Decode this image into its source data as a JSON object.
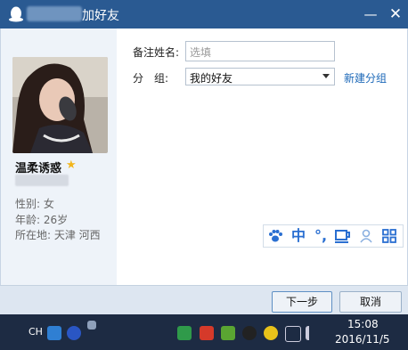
{
  "window": {
    "title_suffix": "加好友",
    "minimize_glyph": "—",
    "close_glyph": "✕"
  },
  "contact": {
    "name": "温柔诱惑",
    "star_glyph": "★",
    "gender_line": "性别: 女",
    "age_line": "年龄: 26岁",
    "location_line": "所在地: 天津 河西"
  },
  "form": {
    "remark_label": "备注姓名:",
    "remark_placeholder": "选填",
    "group_label": "分　组:",
    "group_value": "我的好友",
    "new_group_link": "新建分组"
  },
  "ime_toolbar": {
    "items": [
      "paw-icon",
      "中",
      "°,",
      "cup-icon",
      "person-icon",
      "grid-icon"
    ],
    "lang": "中",
    "punct": "°,"
  },
  "buttons": {
    "next": "下一步",
    "cancel": "取消"
  },
  "taskbar": {
    "lang": "CH",
    "time": "15:08",
    "date": "2016/11/5"
  },
  "colors": {
    "titlebar": "#2a5a92",
    "link": "#1c68b8",
    "taskbar": "#1d2b43",
    "star": "#f2b51b",
    "ime": "#2a6fd1"
  }
}
